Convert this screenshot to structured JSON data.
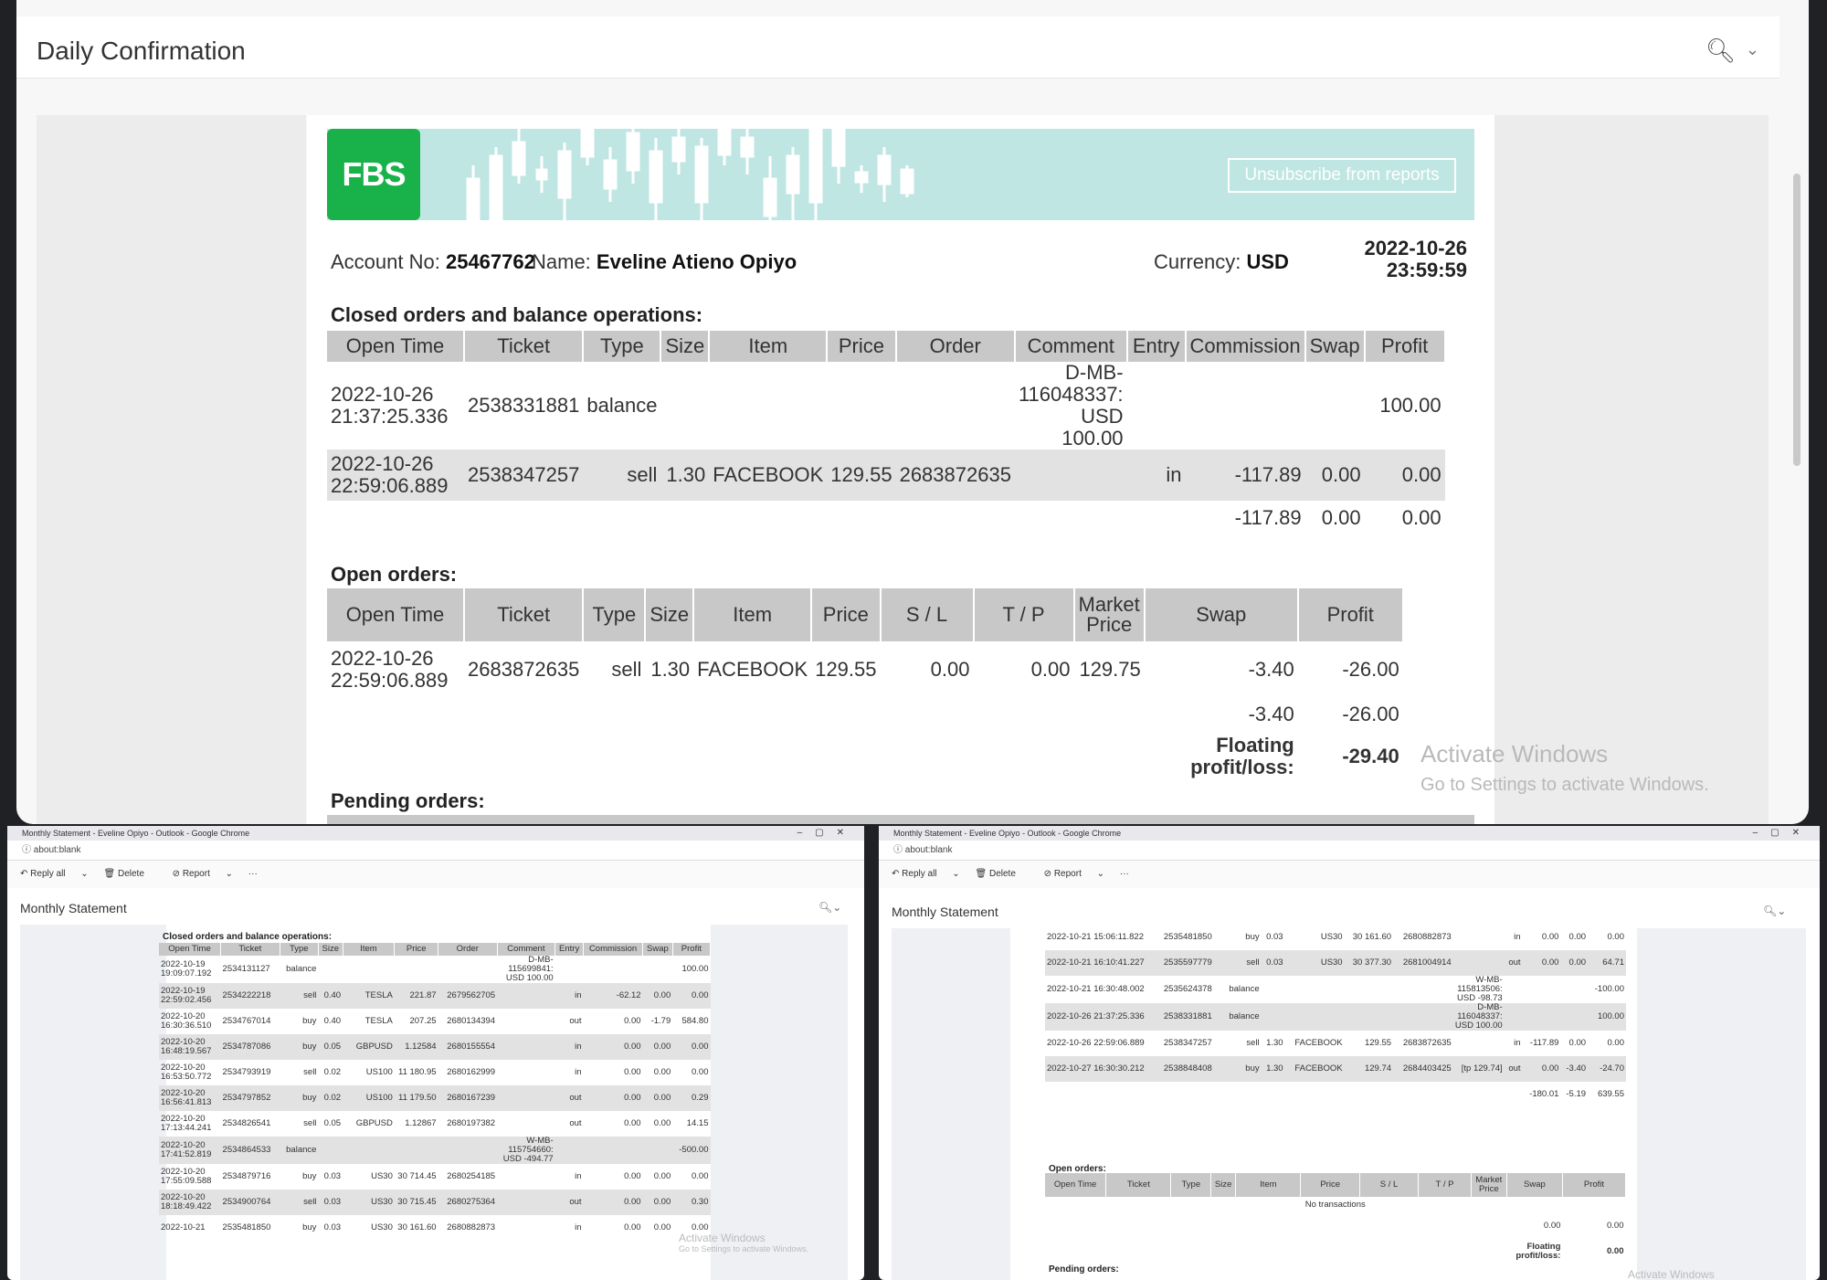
{
  "top": {
    "title": "Daily Confirmation",
    "report": {
      "brand": "FBS",
      "unsubscribe": "Unsubscribe from reports",
      "account_label": "Account No:",
      "account_no": "25467762",
      "name_label": "Name:",
      "name": "Eveline Atieno Opiyo",
      "currency_label": "Currency:",
      "currency": "USD",
      "date": "2022-10-26",
      "time": "23:59:59",
      "closed_title": "Closed orders and balance operations:",
      "closed_headers": [
        "Open Time",
        "Ticket",
        "Type",
        "Size",
        "Item",
        "Price",
        "Order",
        "Comment",
        "Entry",
        "Commission",
        "Swap",
        "Profit"
      ],
      "closed_rows": [
        {
          "time1": "2022-10-26",
          "time2": "21:37:25.336",
          "ticket": "2538331881",
          "type": "balance",
          "size": "",
          "item": "",
          "price": "",
          "order": "",
          "comment1": "D-MB-",
          "comment2": "116048337:",
          "comment3": "USD 100.00",
          "entry": "",
          "commission": "",
          "swap": "",
          "profit": "100.00"
        },
        {
          "time1": "2022-10-26",
          "time2": "22:59:06.889",
          "ticket": "2538347257",
          "type": "sell",
          "size": "1.30",
          "item": "FACEBOOK",
          "price": "129.55",
          "order": "2683872635",
          "comment1": "",
          "comment2": "",
          "comment3": "",
          "entry": "in",
          "commission": "-117.89",
          "swap": "0.00",
          "profit": "0.00"
        }
      ],
      "closed_totals": {
        "commission": "-117.89",
        "swap": "0.00",
        "profit": "0.00"
      },
      "open_title": "Open orders:",
      "open_headers": [
        "Open Time",
        "Ticket",
        "Type",
        "Size",
        "Item",
        "Price",
        "S / L",
        "T / P",
        "Market Price",
        "Swap",
        "Profit"
      ],
      "open_rows": [
        {
          "time1": "2022-10-26",
          "time2": "22:59:06.889",
          "ticket": "2683872635",
          "type": "sell",
          "size": "1.30",
          "item": "FACEBOOK",
          "price": "129.55",
          "sl": "0.00",
          "tp": "0.00",
          "market": "129.75",
          "swap": "-3.40",
          "profit": "-26.00"
        }
      ],
      "open_totals": {
        "swap": "-3.40",
        "profit": "-26.00"
      },
      "floating_label": "Floating profit/loss:",
      "floating_value": "-29.40",
      "pending_title": "Pending orders:"
    },
    "watermark1": "Activate Windows",
    "watermark2": "Go to Settings to activate Windows."
  },
  "left": {
    "window_title": "Monthly Statement - Eveline Opiyo - Outlook - Google Chrome",
    "address": "about:blank",
    "reply_all": "Reply all",
    "delete": "Delete",
    "report": "Report",
    "more": "···",
    "title": "Monthly Statement",
    "closed_title": "Closed orders and balance operations:",
    "headers": [
      "Open Time",
      "Ticket",
      "Type",
      "Size",
      "Item",
      "Price",
      "Order",
      "Comment",
      "Entry",
      "Commission",
      "Swap",
      "Profit"
    ],
    "rows": [
      [
        "2022-10-19 19:09:07.192",
        "2534131127",
        "balance",
        "",
        "",
        "",
        "",
        "D-MB-115699841: USD 100.00",
        "",
        "",
        "",
        "100.00"
      ],
      [
        "2022-10-19 22:59:02.456",
        "2534222218",
        "sell",
        "0.40",
        "TESLA",
        "221.87",
        "2679562705",
        "",
        "in",
        "-62.12",
        "0.00",
        "0.00"
      ],
      [
        "2022-10-20 16:30:36.510",
        "2534767014",
        "buy",
        "0.40",
        "TESLA",
        "207.25",
        "2680134394",
        "",
        "out",
        "0.00",
        "-1.79",
        "584.80"
      ],
      [
        "2022-10-20 16:48:19.567",
        "2534787086",
        "buy",
        "0.05",
        "GBPUSD",
        "1.12584",
        "2680155554",
        "",
        "in",
        "0.00",
        "0.00",
        "0.00"
      ],
      [
        "2022-10-20 16:53:50.772",
        "2534793919",
        "sell",
        "0.02",
        "US100",
        "11 180.95",
        "2680162999",
        "",
        "in",
        "0.00",
        "0.00",
        "0.00"
      ],
      [
        "2022-10-20 16:56:41.813",
        "2534797852",
        "buy",
        "0.02",
        "US100",
        "11 179.50",
        "2680167239",
        "",
        "out",
        "0.00",
        "0.00",
        "0.29"
      ],
      [
        "2022-10-20 17:13:44.241",
        "2534826541",
        "sell",
        "0.05",
        "GBPUSD",
        "1.12867",
        "2680197382",
        "",
        "out",
        "0.00",
        "0.00",
        "14.15"
      ],
      [
        "2022-10-20 17:41:52.819",
        "2534864533",
        "balance",
        "",
        "",
        "",
        "",
        "W-MB-115754660: USD -494.77",
        "",
        "",
        "",
        "-500.00"
      ],
      [
        "2022-10-20 17:55:09.588",
        "2534879716",
        "buy",
        "0.03",
        "US30",
        "30 714.45",
        "2680254185",
        "",
        "in",
        "0.00",
        "0.00",
        "0.00"
      ],
      [
        "2022-10-20 18:18:49.422",
        "2534900764",
        "sell",
        "0.03",
        "US30",
        "30 715.45",
        "2680275364",
        "",
        "out",
        "0.00",
        "0.00",
        "0.30"
      ],
      [
        "2022-10-21",
        "2535481850",
        "buy",
        "0.03",
        "US30",
        "30 161.60",
        "2680882873",
        "",
        "in",
        "0.00",
        "0.00",
        "0.00"
      ]
    ],
    "watermark1": "Activate Windows",
    "watermark2": "Go to Settings to activate Windows."
  },
  "right": {
    "window_title": "Monthly Statement - Eveline Opiyo - Outlook - Google Chrome",
    "address": "about:blank",
    "reply_all": "Reply all",
    "delete": "Delete",
    "report": "Report",
    "more": "···",
    "title": "Monthly Statement",
    "rows": [
      [
        "2022-10-21 15:06:11.822",
        "2535481850",
        "buy",
        "0.03",
        "US30",
        "30 161.60",
        "2680882873",
        "",
        "in",
        "0.00",
        "0.00",
        "0.00"
      ],
      [
        "2022-10-21 16:10:41.227",
        "2535597779",
        "sell",
        "0.03",
        "US30",
        "30 377.30",
        "2681004914",
        "",
        "out",
        "0.00",
        "0.00",
        "64.71"
      ],
      [
        "2022-10-21 16:30:48.002",
        "2535624378",
        "balance",
        "",
        "",
        "",
        "",
        "W-MB-115813506: USD -98.73",
        "",
        "",
        "",
        "-100.00"
      ],
      [
        "2022-10-26 21:37:25.336",
        "2538331881",
        "balance",
        "",
        "",
        "",
        "",
        "D-MB-116048337: USD 100.00",
        "",
        "",
        "",
        "100.00"
      ],
      [
        "2022-10-26 22:59:06.889",
        "2538347257",
        "sell",
        "1.30",
        "FACEBOOK",
        "129.55",
        "2683872635",
        "",
        "in",
        "-117.89",
        "0.00",
        "0.00"
      ],
      [
        "2022-10-27 16:30:30.212",
        "2538848408",
        "buy",
        "1.30",
        "FACEBOOK",
        "129.74",
        "2684403425",
        "[tp 129.74]",
        "out",
        "0.00",
        "-3.40",
        "-24.70"
      ]
    ],
    "totals": {
      "commission": "-180.01",
      "swap": "-5.19",
      "profit": "639.55"
    },
    "open_title": "Open orders:",
    "open_headers": [
      "Open Time",
      "Ticket",
      "Type",
      "Size",
      "Item",
      "Price",
      "S / L",
      "T / P",
      "Market Price",
      "Swap",
      "Profit"
    ],
    "no_tx": "No transactions",
    "open_totals": {
      "swap": "0.00",
      "profit": "0.00"
    },
    "floating_label": "Floating profit/loss:",
    "floating_value": "0.00",
    "pending_title": "Pending orders:",
    "watermark1": "Activate Windows"
  }
}
